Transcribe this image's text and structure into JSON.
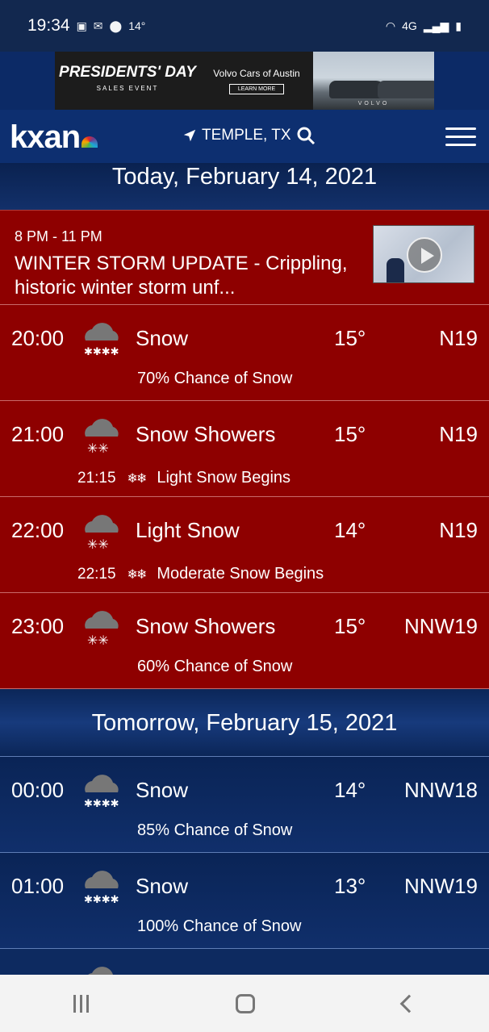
{
  "status_bar": {
    "time": "19:34",
    "notification_icons": [
      "kxan-icon",
      "gmail-icon",
      "location-icon"
    ],
    "temp": "14°",
    "network": "4G"
  },
  "ad": {
    "headline": "PRESIDENTS' DAY",
    "subline": "SALES EVENT",
    "advertiser": "Volvo Cars of Austin",
    "cta": "LEARN MORE",
    "brand": "VOLVO"
  },
  "header": {
    "logo": "kxan",
    "location": "TEMPLE, TX"
  },
  "today": {
    "title": "Today, February 14, 2021",
    "storm": {
      "time": "8 PM - 11 PM",
      "text": "WINTER STORM UPDATE  -  Crippling, historic winter storm unf..."
    },
    "hours": [
      {
        "time": "20:00",
        "condition": "Snow",
        "temp": "15°",
        "wind": "N19",
        "note": "70% Chance of Snow"
      },
      {
        "time": "21:00",
        "condition": "Snow Showers",
        "temp": "15°",
        "wind": "N19",
        "event_time": "21:15",
        "event": "Light Snow Begins"
      },
      {
        "time": "22:00",
        "condition": "Light Snow",
        "temp": "14°",
        "wind": "N19",
        "event_time": "22:15",
        "event": "Moderate Snow Begins"
      },
      {
        "time": "23:00",
        "condition": "Snow Showers",
        "temp": "15°",
        "wind": "NNW19",
        "note": "60% Chance of Snow"
      }
    ]
  },
  "tomorrow": {
    "title": "Tomorrow, February 15, 2021",
    "hours": [
      {
        "time": "00:00",
        "condition": "Snow",
        "temp": "14°",
        "wind": "NNW18",
        "note": "85% Chance of Snow"
      },
      {
        "time": "01:00",
        "condition": "Snow",
        "temp": "13°",
        "wind": "NNW19",
        "note": "100% Chance of Snow"
      }
    ]
  }
}
